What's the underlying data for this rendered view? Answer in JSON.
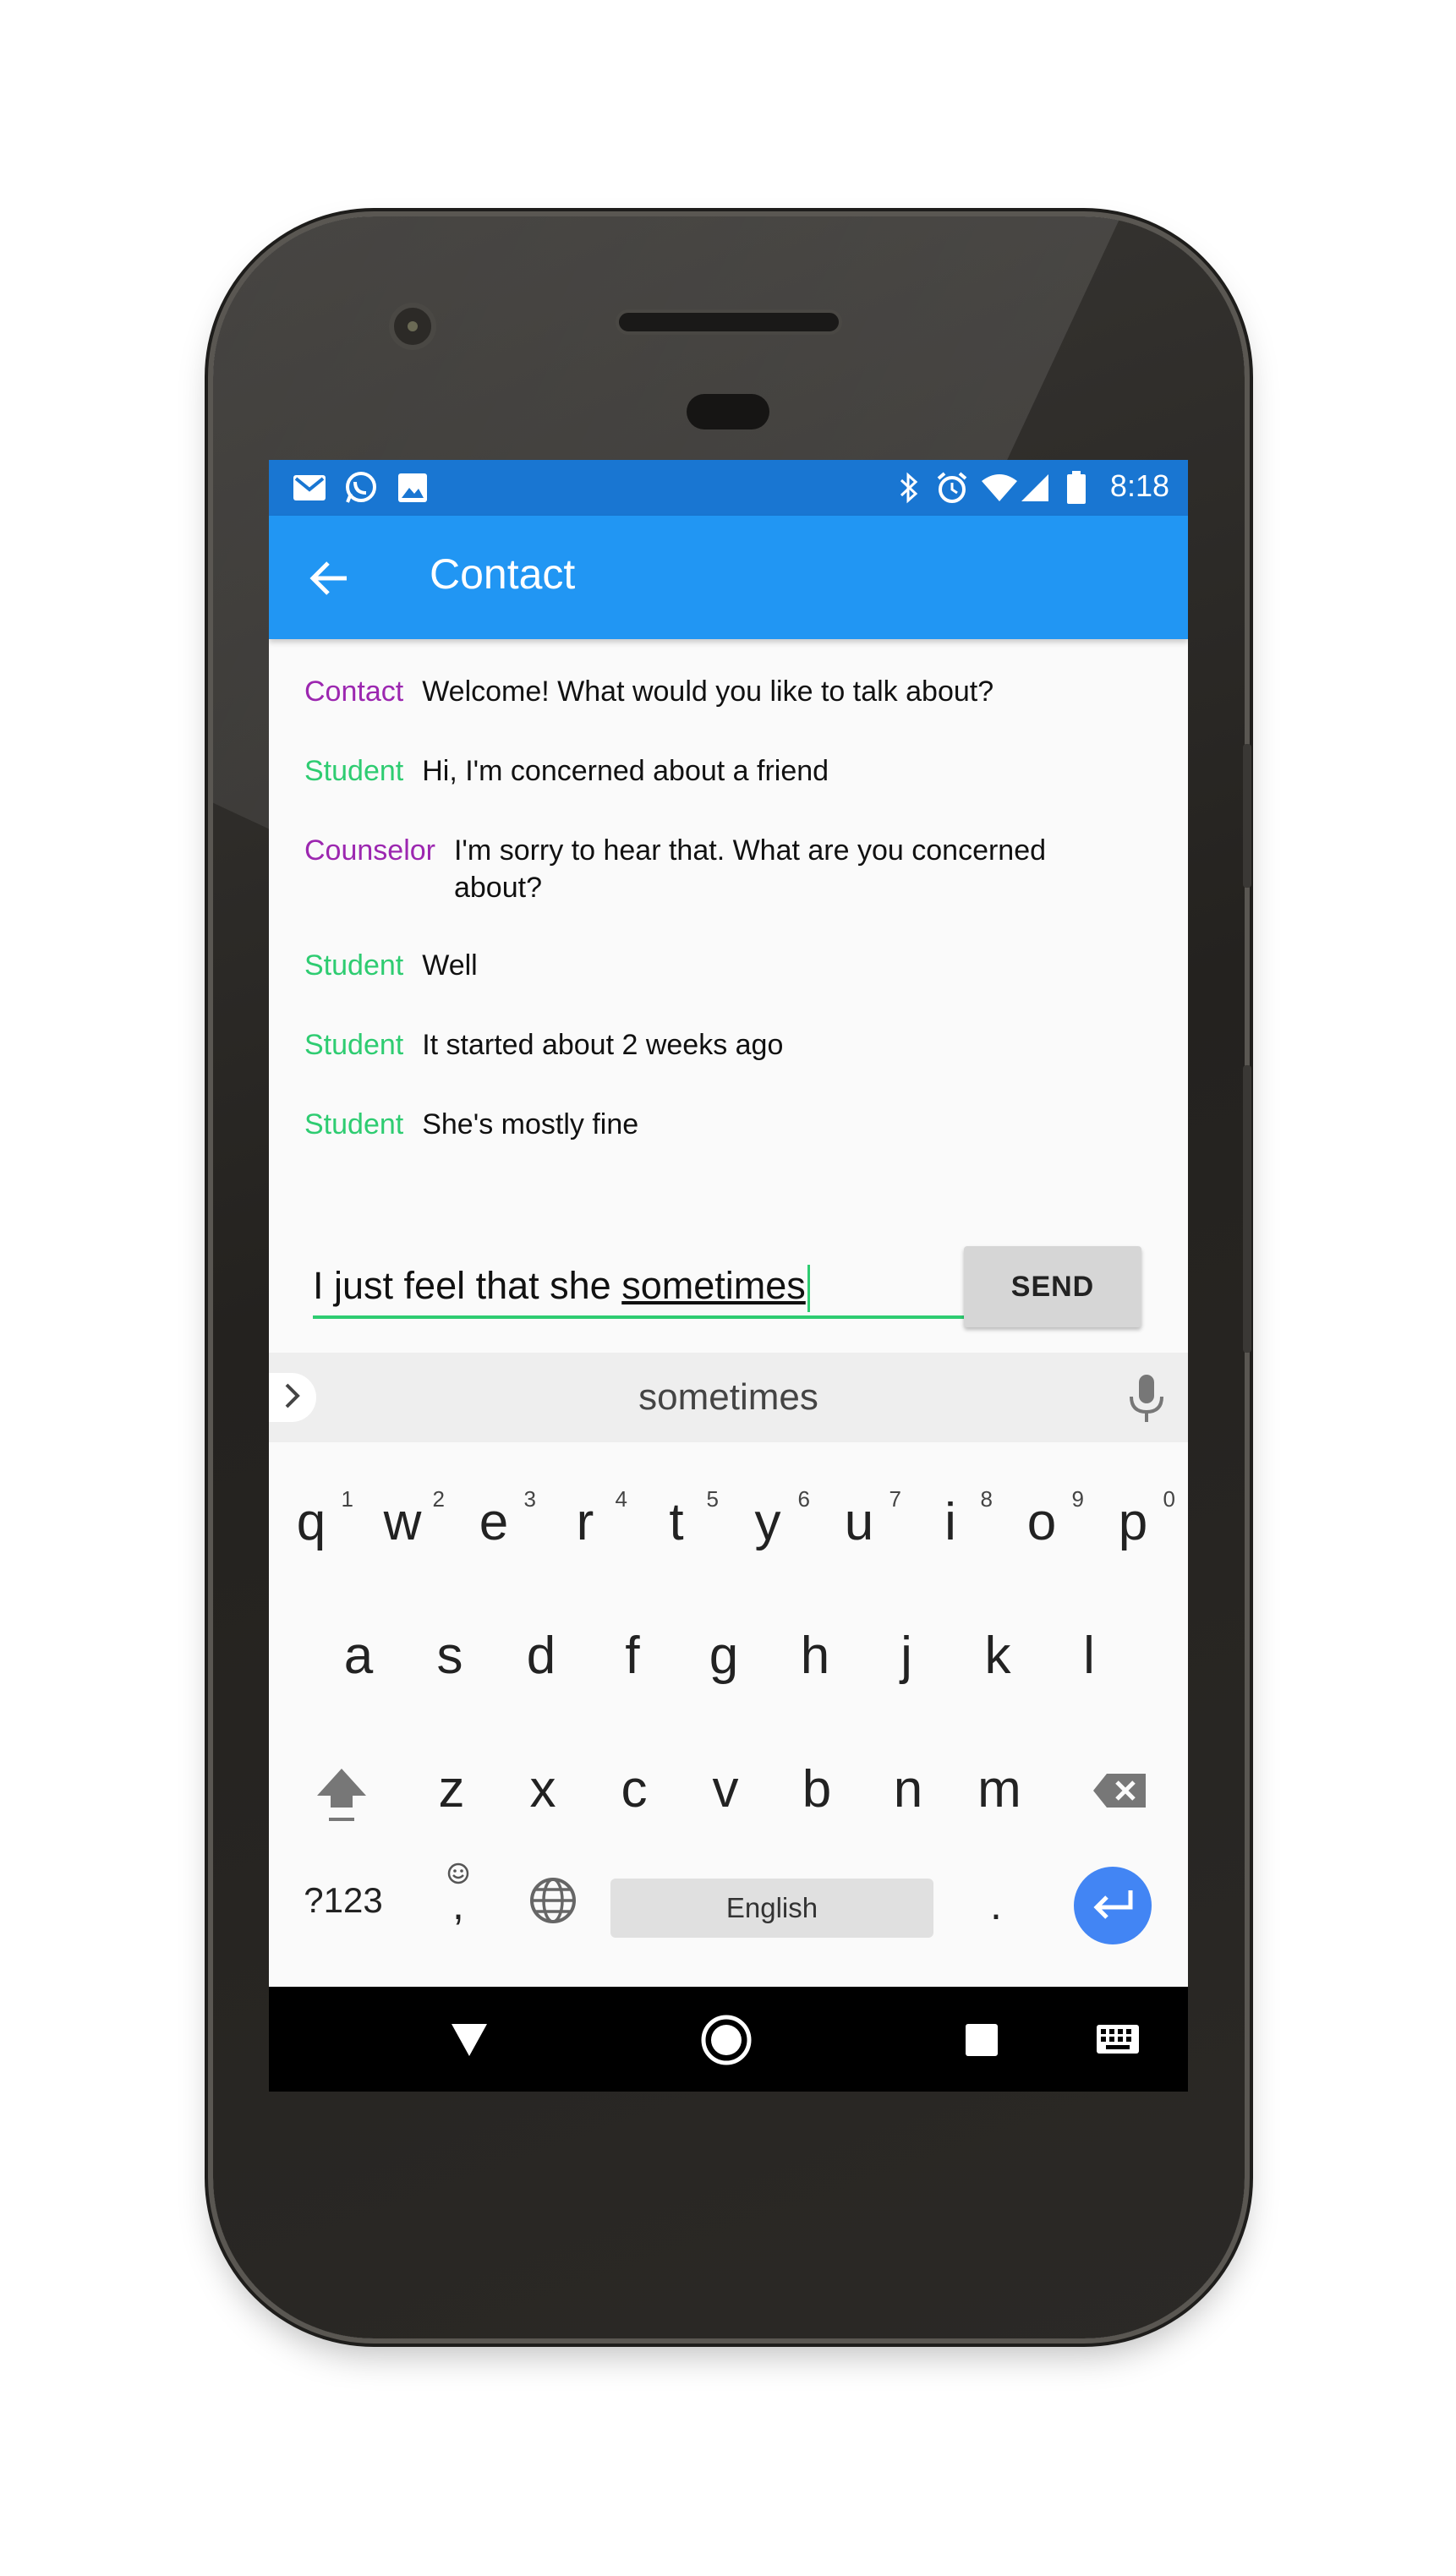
{
  "status_bar": {
    "time": "8:18",
    "left_icons": [
      "gmail-icon",
      "whatsapp-icon",
      "image-icon"
    ],
    "right_icons": [
      "bluetooth-icon",
      "alarm-icon",
      "wifi-icon",
      "signal-icon",
      "battery-icon"
    ]
  },
  "app_bar": {
    "title": "Contact",
    "back_icon": "arrow-left-icon",
    "color": "#2196f3",
    "status_color": "#1976d2"
  },
  "messages": [
    {
      "sender": "Contact",
      "sender_color": "#9c27b0",
      "text": "Welcome! What would you like to talk about?"
    },
    {
      "sender": "Student",
      "sender_color": "#2ecc71",
      "text": "Hi, I'm concerned about a friend"
    },
    {
      "sender": "Counselor",
      "sender_color": "#9c27b0",
      "text": "I'm sorry to hear that. What are you concerned about?"
    },
    {
      "sender": "Student",
      "sender_color": "#2ecc71",
      "text": "Well"
    },
    {
      "sender": "Student",
      "sender_color": "#2ecc71",
      "text": "It started about 2 weeks ago"
    },
    {
      "sender": "Student",
      "sender_color": "#2ecc71",
      "text": "She's mostly fine"
    }
  ],
  "composer": {
    "value_prefix": "I just feel that she ",
    "value_composing": "sometimes",
    "send_label": "SEND",
    "accent": "#2ecc71"
  },
  "keyboard": {
    "suggestion": "sometimes",
    "row1": [
      {
        "ch": "q",
        "hint": "1"
      },
      {
        "ch": "w",
        "hint": "2"
      },
      {
        "ch": "e",
        "hint": "3"
      },
      {
        "ch": "r",
        "hint": "4"
      },
      {
        "ch": "t",
        "hint": "5"
      },
      {
        "ch": "y",
        "hint": "6"
      },
      {
        "ch": "u",
        "hint": "7"
      },
      {
        "ch": "i",
        "hint": "8"
      },
      {
        "ch": "o",
        "hint": "9"
      },
      {
        "ch": "p",
        "hint": "0"
      }
    ],
    "row2": [
      "a",
      "s",
      "d",
      "f",
      "g",
      "h",
      "j",
      "k",
      "l"
    ],
    "row3": [
      "z",
      "x",
      "c",
      "v",
      "b",
      "n",
      "m"
    ],
    "symbols_label": "?123",
    "comma_label": ",",
    "space_label": "English",
    "period_label": ".",
    "enter_color": "#4285f4"
  },
  "nav_bar": {
    "icons": [
      "back-triangle-icon",
      "home-circle-icon",
      "recents-square-icon",
      "keyboard-icon"
    ]
  }
}
